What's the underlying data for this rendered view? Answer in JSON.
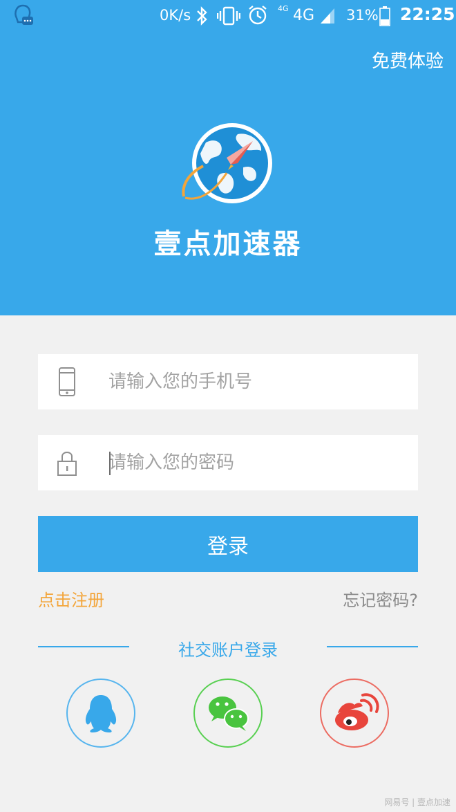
{
  "status_bar": {
    "net_speed": "0K/s",
    "net_small": "4G",
    "net_big": "4G",
    "battery_pct": "31%",
    "time": "22:25"
  },
  "header": {
    "free_trial": "免费体验",
    "app_name": "壹点加速器"
  },
  "form": {
    "phone_placeholder": "请输入您的手机号",
    "password_placeholder": "请输入您的密码",
    "login_label": "登录",
    "register_label": "点击注册",
    "forgot_label": "忘记密码?"
  },
  "social": {
    "title": "社交账户登录",
    "items": [
      "qq",
      "wechat",
      "weibo"
    ]
  },
  "watermark": "网易号 | 壹点加速",
  "colors": {
    "primary": "#38a8ea",
    "register": "#f3a53a",
    "qq": "#57b5ee",
    "wechat": "#59d052",
    "weibo": "#ec6c62"
  }
}
